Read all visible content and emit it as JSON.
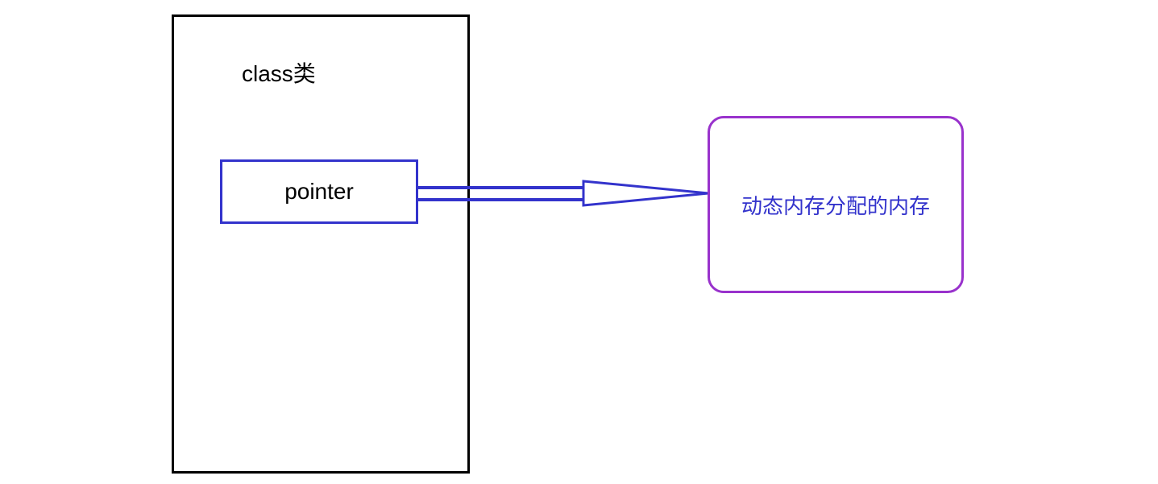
{
  "diagram": {
    "class_box": {
      "title": "class类"
    },
    "pointer_box": {
      "label": "pointer"
    },
    "memory_box": {
      "label": "动态内存分配的内存"
    },
    "colors": {
      "class_border": "#000000",
      "pointer_border": "#3333cc",
      "memory_border": "#9932cc",
      "arrow_color": "#3333cc",
      "memory_text": "#3333cc"
    }
  }
}
